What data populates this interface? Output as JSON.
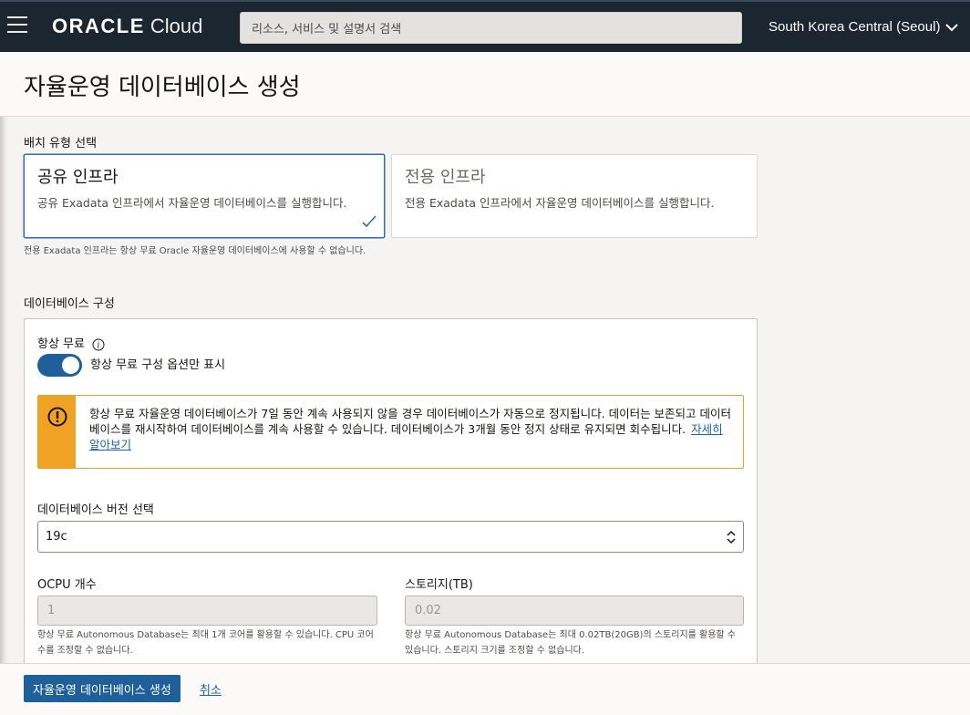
{
  "topbar": {
    "brand_oracle": "ORACLE",
    "brand_cloud": "Cloud",
    "search_placeholder": "리소스, 서비스 및 설명서 검색",
    "region": "South Korea Central (Seoul)"
  },
  "page": {
    "title": "자율운영 데이터베이스 생성"
  },
  "deployment": {
    "label": "배치 유형 선택",
    "options": [
      {
        "title": "공유 인프라",
        "desc": "공유 Exadata 인프라에서 자율운영 데이터베이스를 실행합니다.",
        "selected": true
      },
      {
        "title": "전용 인프라",
        "desc": "전용 Exadata 인프라에서 자율운영 데이터베이스를 실행합니다.",
        "selected": false
      }
    ],
    "note": "전용 Exadata 인프라는 항상 무료 Oracle 자율운영 데이터베이스에 사용할 수 없습니다."
  },
  "config": {
    "section_label": "데이터베이스 구성",
    "always_free_label": "항상 무료",
    "toggle_label": "항상 무료 구성 옵션만 표시",
    "toggle_on": true,
    "alert_text": "항상 무료 자율운영 데이터베이스가 7일 동안 계속 사용되지 않을 경우 데이터베이스가 자동으로 정지됩니다. 데이터는 보존되고 데이터베이스를 재시작하여 데이터베이스를 계속 사용할 수 있습니다. 데이터베이스가 3개월 동안 정지 상태로 유지되면 회수됩니다.",
    "alert_link": "자세히 알아보기",
    "version_label": "데이터베이스 버전 선택",
    "version_value": "19c",
    "ocpu_label": "OCPU 개수",
    "ocpu_value": "1",
    "ocpu_help": "항상 무료 Autonomous Database는 최대 1개 코어를 활용할 수 있습니다. CPU 코어 수를 조정할 수 없습니다.",
    "storage_label": "스토리지(TB)",
    "storage_value": "0.02",
    "storage_help": "항상 무료 Autonomous Database는 최대 0.02TB(20GB)의 스토리지를 활용할 수 있습니다. 스토리지 크기를 조정할 수 없습니다."
  },
  "footer": {
    "create_label": "자율운영 데이터베이스 생성",
    "cancel_label": "취소"
  },
  "colors": {
    "nav_bg": "#1c2630",
    "primary": "#1f5f9a",
    "warning": "#f0a224",
    "link": "#1f62a8"
  }
}
